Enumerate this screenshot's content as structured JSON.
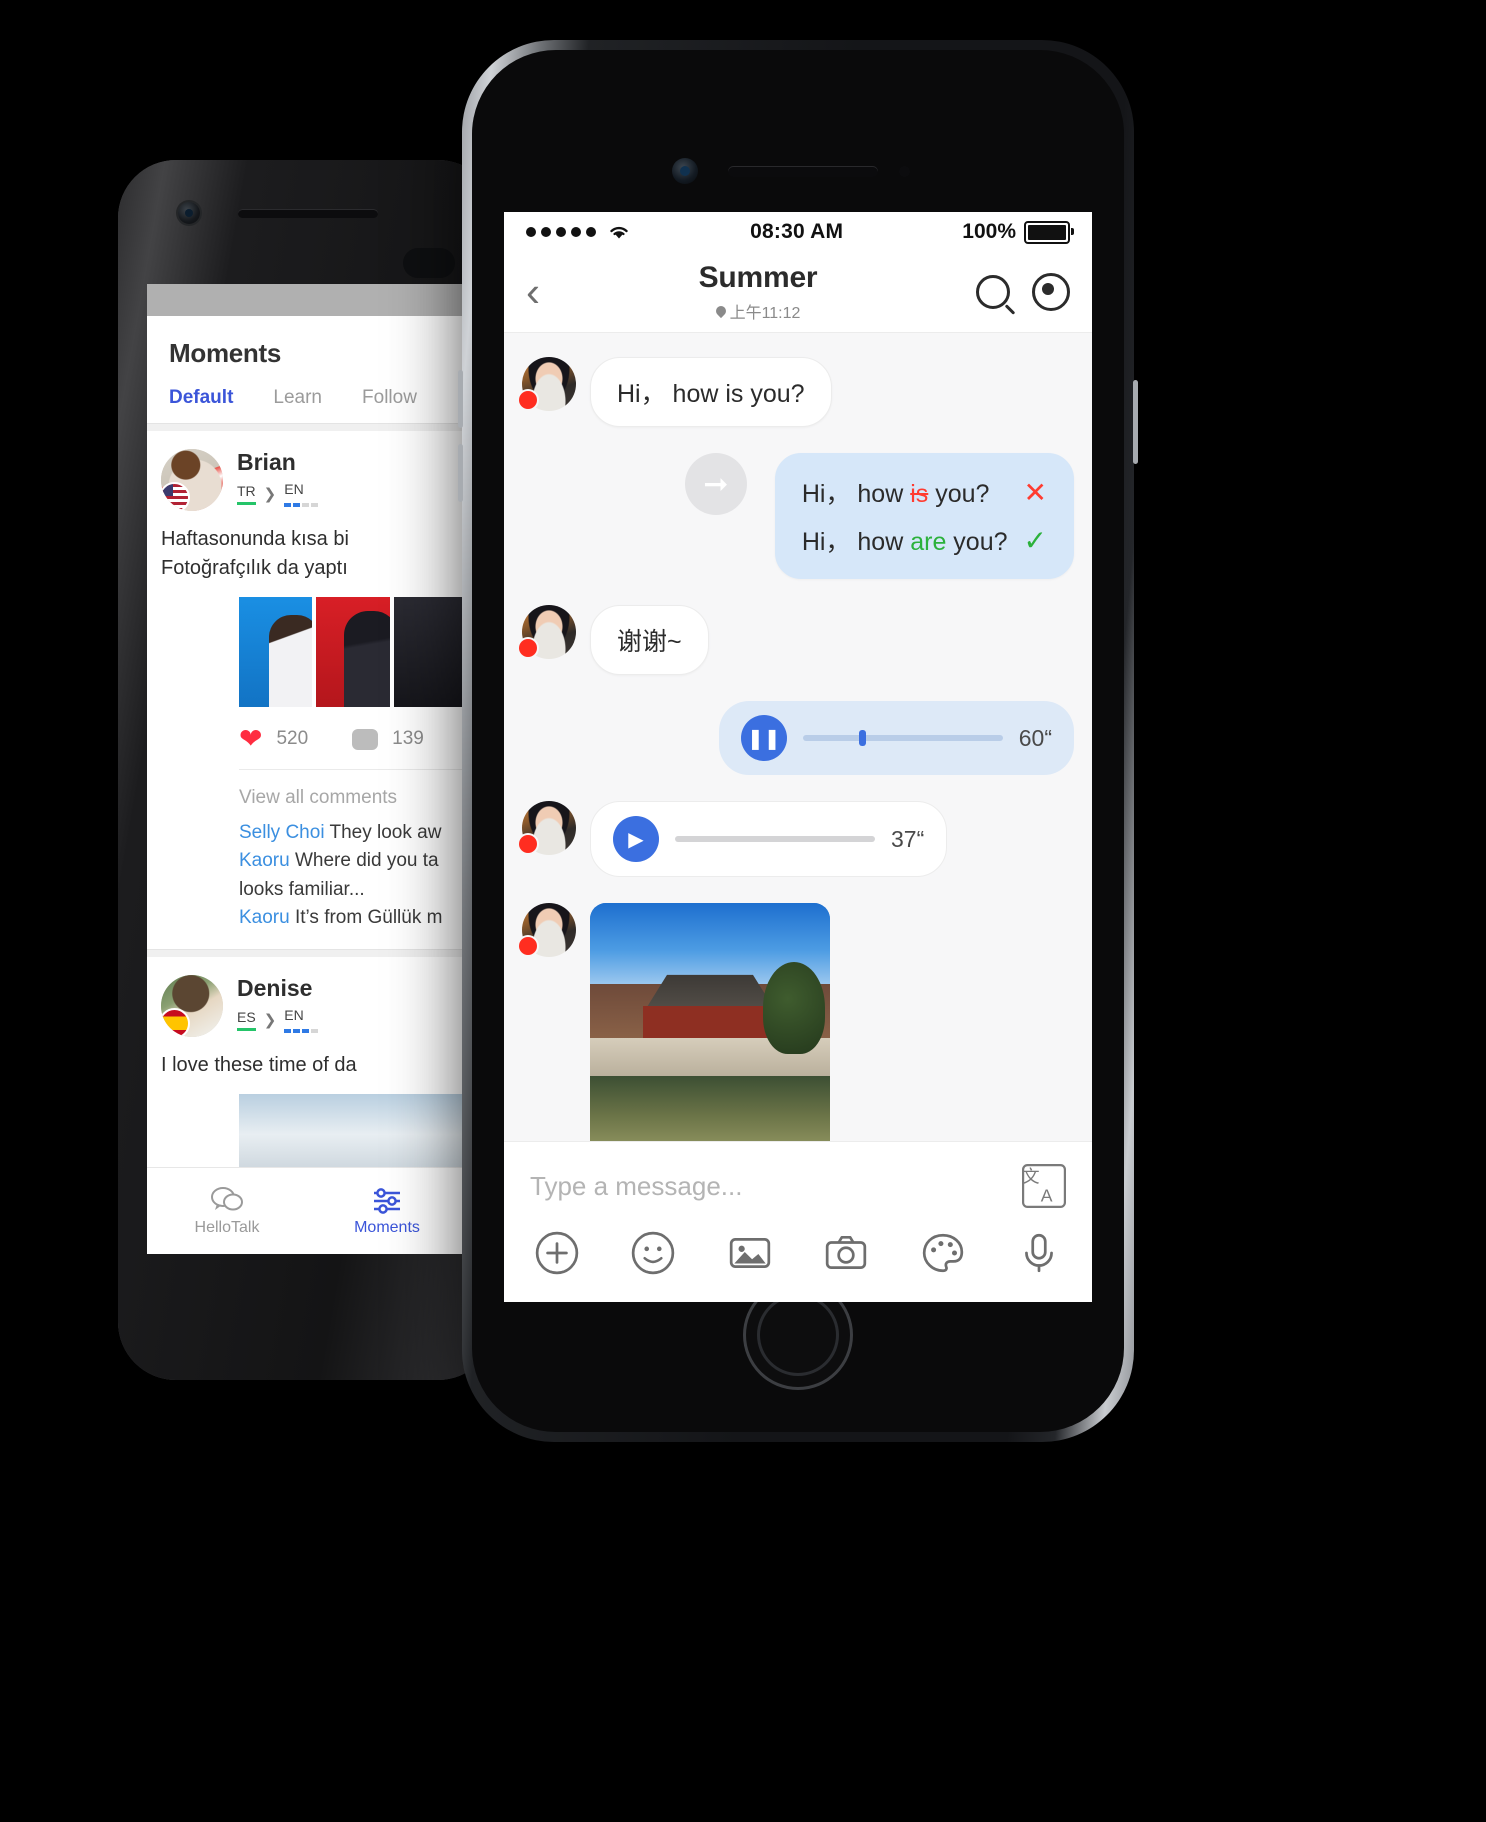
{
  "left_phone": {
    "title": "Moments",
    "tabs": [
      {
        "label": "Default",
        "active": true
      },
      {
        "label": "Learn",
        "active": false
      },
      {
        "label": "Follow",
        "active": false
      }
    ],
    "posts": [
      {
        "name": "Brian",
        "lang_from": "TR",
        "lang_to": "EN",
        "flag": "us-flag-icon",
        "body": "Haftasonunda kısa bi\nFotoğrafçılık da yaptı",
        "likes": "520",
        "comments_count": "139",
        "view_all": "View all comments",
        "comments": [
          {
            "name": "Selly Choi",
            "text": "They look aw"
          },
          {
            "name": "Kaoru",
            "text": "Where did you ta"
          },
          {
            "name": "",
            "text": "looks familiar..."
          },
          {
            "name": "Kaoru",
            "text": "It’s from Güllük m"
          }
        ]
      },
      {
        "name": "Denise",
        "lang_from": "ES",
        "lang_to": "EN",
        "flag": "es-flag-icon",
        "body": "I love these time of da"
      }
    ],
    "tabbar": [
      {
        "label": "HelloTalk",
        "icon": "chat-icon",
        "active": false
      },
      {
        "label": "Moments",
        "icon": "sliders-icon",
        "active": true
      }
    ]
  },
  "right_phone": {
    "status": {
      "signal": "●●●●●",
      "wifi": "wifi-icon",
      "time": "08:30 AM",
      "battery_percent": "100%",
      "battery_icon": "battery-full-icon"
    },
    "nav": {
      "back": "back-chevron-icon",
      "title": "Summer",
      "subtitle": "上午11:12",
      "pin_icon": "location-pin-icon",
      "search_icon": "search-icon",
      "target_icon": "target-icon"
    },
    "messages": [
      {
        "type": "text",
        "side": "left",
        "avatar": "summer-avatar",
        "text": "Hi， how is you?"
      },
      {
        "type": "correction",
        "side": "right",
        "forward_icon": "forward-arrow-icon",
        "lines": [
          {
            "prefix": "Hi， how ",
            "marked": "is",
            "suffix": " you?",
            "mark_type": "strike",
            "status": "✕",
            "status_type": "error"
          },
          {
            "prefix": "Hi， how ",
            "marked": "are",
            "suffix": " you?",
            "mark_type": "fix",
            "status": "✓",
            "status_type": "ok"
          }
        ]
      },
      {
        "type": "text",
        "side": "left",
        "avatar": "summer-avatar",
        "text": "谢谢~"
      },
      {
        "type": "audio",
        "side": "right",
        "state": "playing",
        "icon": "pause-icon",
        "duration": "60“"
      },
      {
        "type": "audio",
        "side": "left",
        "avatar": "summer-avatar",
        "state": "paused",
        "icon": "play-icon",
        "duration": "37“"
      },
      {
        "type": "image",
        "side": "left",
        "avatar": "summer-avatar",
        "alt": "forbidden-city-corner-tower-photo"
      }
    ],
    "input": {
      "placeholder": "Type a message...",
      "translate_icon": "translate-icon"
    },
    "toolbar": [
      {
        "icon": "plus-circle-icon",
        "name": "add-button"
      },
      {
        "icon": "smiley-icon",
        "name": "emoji-button"
      },
      {
        "icon": "image-icon",
        "name": "gallery-button"
      },
      {
        "icon": "camera-icon",
        "name": "camera-button"
      },
      {
        "icon": "palette-icon",
        "name": "doodle-button"
      },
      {
        "icon": "microphone-icon",
        "name": "voice-button"
      }
    ]
  },
  "colors": {
    "accent_blue": "#3b55d9",
    "bubble_blue": "#d6e7f9",
    "error_red": "#ff3b30",
    "ok_green": "#2bb13b",
    "heart_red": "#ff2d41",
    "play_blue": "#3b6fe0"
  }
}
